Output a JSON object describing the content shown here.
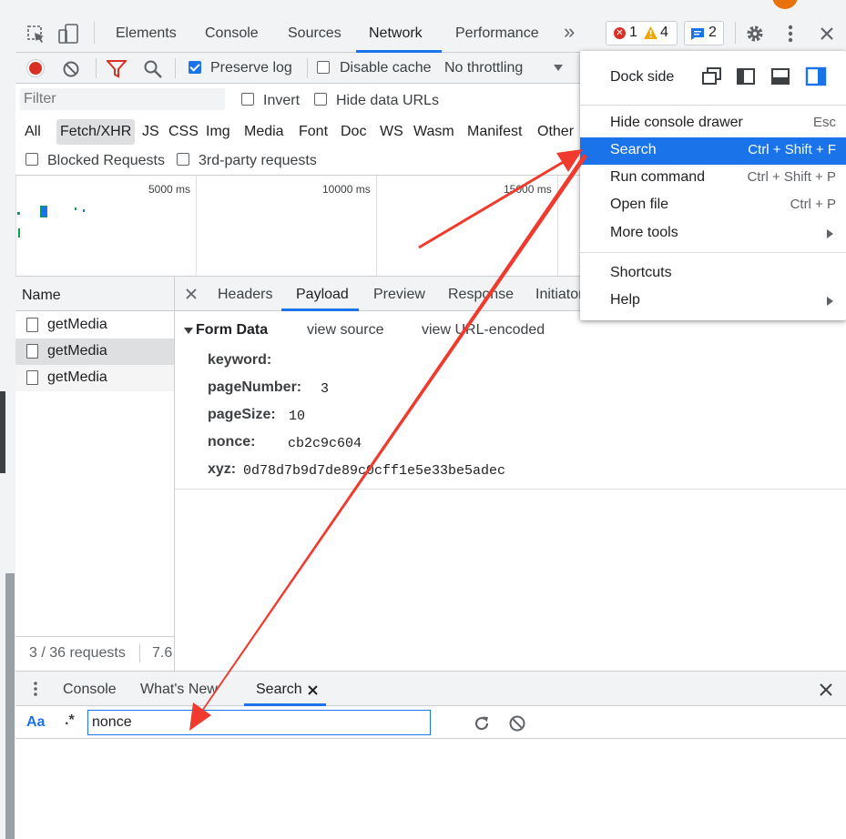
{
  "toolbar": {
    "tabs": [
      "Elements",
      "Console",
      "Sources",
      "Network",
      "Performance"
    ],
    "active_tab": "Network",
    "more_tabs": "»",
    "errors": "1",
    "warnings": "4",
    "messages": "2"
  },
  "network_bar": {
    "preserve_log": "Preserve log",
    "disable_cache": "Disable cache",
    "throttling": "No throttling"
  },
  "filter": {
    "placeholder": "Filter",
    "invert": "Invert",
    "hide_data_urls": "Hide data URLs",
    "types": [
      "All",
      "Fetch/XHR",
      "JS",
      "CSS",
      "Img",
      "Media",
      "Font",
      "Doc",
      "WS",
      "Wasm",
      "Manifest",
      "Other"
    ],
    "active_type": "Fetch/XHR",
    "blocked_requests": "Blocked Requests",
    "third_party": "3rd-party requests"
  },
  "timeline": {
    "ticks": [
      "5000 ms",
      "10000 ms",
      "15000 ms"
    ]
  },
  "requests": {
    "header": "Name",
    "items": [
      "getMedia",
      "getMedia",
      "getMedia"
    ],
    "status": "3 / 36 requests",
    "size": "7.6"
  },
  "detail": {
    "tabs": [
      "Headers",
      "Payload",
      "Preview",
      "Response",
      "Initiator"
    ],
    "active_tab": "Payload",
    "section_title": "Form Data",
    "view_source": "view source",
    "view_url_encoded": "view URL-encoded",
    "fields": [
      {
        "key": "keyword:",
        "value": ""
      },
      {
        "key": "pageNumber:",
        "value": "3"
      },
      {
        "key": "pageSize:",
        "value": "10"
      },
      {
        "key": "nonce:",
        "value": "cb2c9c604"
      },
      {
        "key": "xyz:",
        "value": "0d78d7b9d7de89c0cff1e5e33be5adec"
      }
    ]
  },
  "drawer": {
    "tabs": [
      "Console",
      "What's New",
      "Search"
    ],
    "active_tab": "Search",
    "case_toggle": "Aa",
    "regex_toggle": ".*",
    "search_value": "nonce"
  },
  "menu": {
    "dock_side": "Dock side",
    "items": [
      {
        "label": "Hide console drawer",
        "shortcut": "Esc"
      },
      {
        "label": "Search",
        "shortcut": "Ctrl + Shift + F"
      },
      {
        "label": "Run command",
        "shortcut": "Ctrl + Shift + P"
      },
      {
        "label": "Open file",
        "shortcut": "Ctrl + P"
      },
      {
        "label": "More tools",
        "shortcut": ""
      }
    ],
    "items2": [
      {
        "label": "Shortcuts",
        "shortcut": ""
      },
      {
        "label": "Help",
        "shortcut": ""
      }
    ]
  },
  "colors": {
    "accent": "#1a73e8",
    "annotation_arrow": "#f03a2e",
    "selected_row": "#dedfe1"
  }
}
